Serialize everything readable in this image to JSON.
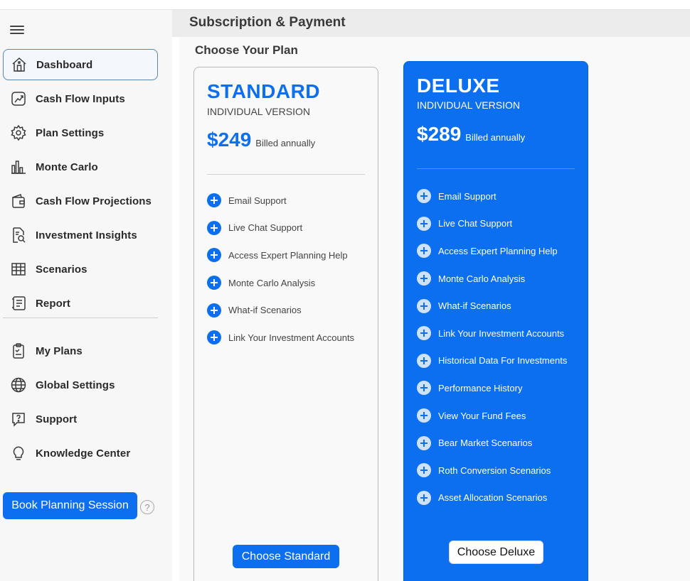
{
  "page": {
    "title": "Subscription & Payment",
    "section_title": "Choose Your Plan"
  },
  "sidebar": {
    "items": [
      {
        "label": "Dashboard",
        "icon": "home-icon",
        "active": true
      },
      {
        "label": "Cash Flow Inputs",
        "icon": "trend-chart-icon"
      },
      {
        "label": "Plan Settings",
        "icon": "gear-icon"
      },
      {
        "label": "Monte Carlo",
        "icon": "bar-chart-icon"
      },
      {
        "label": "Cash Flow Projections",
        "icon": "wallet-icon"
      },
      {
        "label": "Investment Insights",
        "icon": "document-search-icon"
      },
      {
        "label": "Scenarios",
        "icon": "table-icon"
      },
      {
        "label": "Report",
        "icon": "report-icon"
      }
    ],
    "bottom_items": [
      {
        "label": "My Plans",
        "icon": "clipboard-icon"
      },
      {
        "label": "Global Settings",
        "icon": "globe-icon"
      },
      {
        "label": "Support",
        "icon": "question-bubble-icon"
      },
      {
        "label": "Knowledge Center",
        "icon": "lightbulb-icon"
      }
    ],
    "book_button": "Book Planning Session",
    "help_glyph": "?"
  },
  "plans": {
    "standard": {
      "name": "STANDARD",
      "version": "INDIVIDUAL VERSION",
      "price": "$249",
      "billing": "Billed annually",
      "features": [
        "Email Support",
        "Live Chat Support",
        "Access Expert Planning Help",
        "Monte Carlo Analysis",
        "What-if Scenarios",
        "Link Your Investment Accounts"
      ],
      "button": "Choose Standard"
    },
    "deluxe": {
      "name": "DELUXE",
      "version": "INDIVIDUAL VERSION",
      "price": "$289",
      "billing": "Billed annually",
      "features": [
        "Email Support",
        "Live Chat Support",
        "Access Expert Planning Help",
        "Monte Carlo Analysis",
        "What-if Scenarios",
        "Link Your Investment Accounts",
        "Historical Data For Investments",
        "Performance History",
        "View Your Fund Fees",
        "Bear Market Scenarios",
        "Roth Conversion Scenarios",
        "Asset Allocation Scenarios"
      ],
      "button": "Choose Deluxe"
    }
  },
  "colors": {
    "accent": "#0b6ff0",
    "sidebar_bg": "#f7f7f7",
    "header_bg": "#ececec"
  }
}
